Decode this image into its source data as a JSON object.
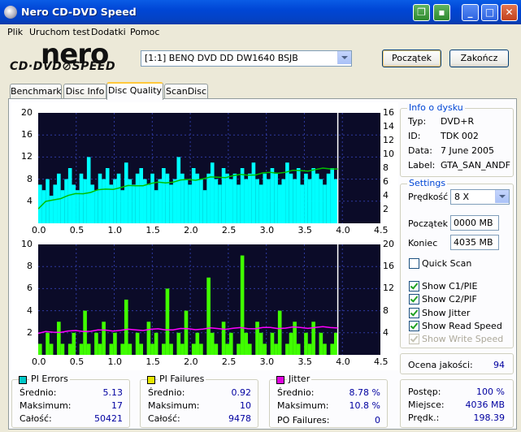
{
  "window": {
    "title": "Nero CD-DVD Speed"
  },
  "menu": [
    "Plik",
    "Uruchom test",
    "Dodatki",
    "Pomoc"
  ],
  "toolbar": {
    "logo_top": "nero",
    "logo_bottom": "CD·DVD⊘SPEED",
    "drive": "[1:1]   BENQ DVD DD DW1640 BSJB",
    "start_label": "Początek",
    "end_label": "Zakończ"
  },
  "tabs": [
    "Benchmark",
    "Disc Info",
    "Disc Quality",
    "ScanDisc"
  ],
  "active_tab": "Disc Quality",
  "disc_info": {
    "title": "Info o dysku",
    "type_label": "Typ:",
    "type_value": "DVD+R",
    "id_label": "ID:",
    "id_value": "TDK 002",
    "date_label": "Data:",
    "date_value": "7 June 2005",
    "label_label": "Label:",
    "label_value": "GTA_SAN_ANDF"
  },
  "settings": {
    "title": "Settings",
    "speed_label": "Prędkość",
    "speed_value": "8 X",
    "start_label": "Początek",
    "start_value": "0000 MB",
    "end_label": "Koniec",
    "end_value": "4035 MB",
    "checkboxes": [
      {
        "label": "Quick Scan",
        "checked": false,
        "disabled": false
      },
      {
        "label": "Show C1/PIE",
        "checked": true,
        "disabled": false
      },
      {
        "label": "Show C2/PIF",
        "checked": true,
        "disabled": false
      },
      {
        "label": "Show Jitter",
        "checked": true,
        "disabled": false
      },
      {
        "label": "Show Read Speed",
        "checked": true,
        "disabled": false
      },
      {
        "label": "Show Write Speed",
        "checked": true,
        "disabled": true
      }
    ]
  },
  "quality": {
    "label": "Ocena jakości:",
    "value": "94"
  },
  "progress": {
    "postep_label": "Postęp:",
    "postep_value": "100 %",
    "miejsce_label": "Miejsce:",
    "miejsce_value": "4036 MB",
    "predk_label": "Prędk.:",
    "predk_value": "198.39"
  },
  "stats": {
    "pi_errors": {
      "title": "PI Errors",
      "color": "#00c8c8",
      "avg_label": "Średnio:",
      "avg": "5.13",
      "max_label": "Maksimum:",
      "max": "17",
      "total_label": "Całość:",
      "total": "50421"
    },
    "pi_failures": {
      "title": "PI Failures",
      "color": "#e8e800",
      "avg_label": "Średnio:",
      "avg": "0.92",
      "max_label": "Maksimum:",
      "max": "10",
      "total_label": "Całość:",
      "total": "9478"
    },
    "jitter": {
      "title": "Jitter",
      "color": "#e000e0",
      "avg_label": "Średnio:",
      "avg": "8.78 %",
      "max_label": "Maksimum:",
      "max": "10.8 %",
      "po_label": "PO Failures:",
      "po": "0"
    }
  },
  "chart_data": [
    {
      "type": "area",
      "x_ticks": [
        "0.0",
        "0.5",
        "1.0",
        "1.5",
        "2.0",
        "2.5",
        "3.0",
        "3.5",
        "4.0",
        "4.5"
      ],
      "y_left_ticks": [
        "20",
        "16",
        "12",
        "8",
        "4"
      ],
      "y_right_ticks": [
        "16",
        "14",
        "12",
        "10",
        "8",
        "6",
        "4",
        "2"
      ],
      "xlim": [
        0,
        4.5
      ],
      "ylim_left": [
        0,
        20
      ],
      "ylim_right": [
        0,
        16
      ],
      "series": [
        {
          "name": "PI Errors",
          "color": "#00ffff",
          "x_end": 3.94,
          "values": [
            7,
            6,
            8,
            5,
            7,
            9,
            6,
            8,
            10,
            7,
            6,
            9,
            8,
            12,
            7,
            6,
            9,
            8,
            10,
            7,
            8,
            9,
            6,
            11,
            8,
            7,
            9,
            10,
            8,
            7,
            9,
            6,
            8,
            10,
            9,
            7,
            8,
            12,
            9,
            8,
            7,
            10,
            9,
            8,
            6,
            9,
            11,
            8,
            7,
            10,
            9,
            8,
            9,
            7,
            10,
            8,
            9,
            11,
            8,
            7,
            9,
            8,
            10,
            9,
            7,
            8,
            11,
            9,
            8,
            10,
            7,
            9,
            8,
            10,
            9,
            8,
            7,
            9,
            10,
            8
          ]
        },
        {
          "name": "Read Speed",
          "color": "#00c000",
          "start": 2.1,
          "end": 8.0
        }
      ],
      "grid": true
    },
    {
      "type": "area",
      "x_ticks": [
        "0.0",
        "0.5",
        "1.0",
        "1.5",
        "2.0",
        "2.5",
        "3.0",
        "3.5",
        "4.0",
        "4.5"
      ],
      "y_left_ticks": [
        "10",
        "8",
        "6",
        "4",
        "2"
      ],
      "y_right_ticks": [
        "20",
        "16",
        "12",
        "8",
        "4"
      ],
      "xlim": [
        0,
        4.5
      ],
      "ylim_left": [
        0,
        10
      ],
      "ylim_right": [
        0,
        20
      ],
      "series": [
        {
          "name": "PI Failures",
          "color": "#40ff00",
          "x_end": 3.94,
          "values": [
            1,
            0,
            2,
            1,
            0,
            3,
            1,
            0,
            1,
            2,
            0,
            1,
            4,
            1,
            0,
            2,
            1,
            3,
            0,
            1,
            2,
            0,
            1,
            5,
            1,
            0,
            2,
            1,
            0,
            3,
            1,
            2,
            0,
            1,
            6,
            1,
            0,
            2,
            1,
            4,
            0,
            1,
            2,
            1,
            0,
            7,
            2,
            1,
            0,
            3,
            1,
            2,
            0,
            1,
            9,
            2,
            1,
            0,
            3,
            2,
            1,
            0,
            2,
            1,
            4,
            0,
            1,
            2,
            3,
            1,
            0,
            2,
            1,
            3,
            0,
            2,
            1,
            0,
            1,
            2
          ]
        },
        {
          "name": "Jitter",
          "color": "#ff00ff",
          "start": 3.9,
          "end": 5.0
        }
      ],
      "grid": true
    }
  ]
}
